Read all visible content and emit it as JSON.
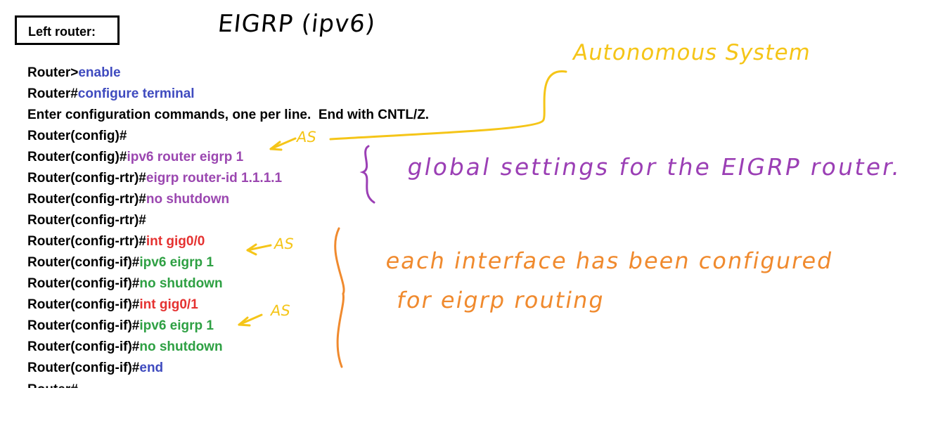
{
  "header": {
    "label": "Left router:",
    "handwritten_title": "EIGRP (ipv6)"
  },
  "cli": {
    "lines": [
      [
        {
          "t": "Router>",
          "c": "black"
        },
        {
          "t": "enable",
          "c": "blue"
        }
      ],
      [
        {
          "t": "Router#",
          "c": "black"
        },
        {
          "t": "configure terminal",
          "c": "blue"
        }
      ],
      [
        {
          "t": "Enter configuration commands, one per line.  End with CNTL/Z.",
          "c": "black"
        }
      ],
      [
        {
          "t": "Router(config)#",
          "c": "black"
        }
      ],
      [
        {
          "t": "Router(config)#",
          "c": "black"
        },
        {
          "t": "ipv6 router eigrp 1",
          "c": "purple"
        }
      ],
      [
        {
          "t": "Router(config-rtr)#",
          "c": "black"
        },
        {
          "t": "eigrp router-id 1.1.1.1",
          "c": "purple"
        }
      ],
      [
        {
          "t": "Router(config-rtr)#",
          "c": "black"
        },
        {
          "t": "no shutdown",
          "c": "purple"
        }
      ],
      [
        {
          "t": "Router(config-rtr)#",
          "c": "black"
        }
      ],
      [
        {
          "t": "Router(config-rtr)#",
          "c": "black"
        },
        {
          "t": "int gig0/0",
          "c": "red"
        }
      ],
      [
        {
          "t": "Router(config-if)#",
          "c": "black"
        },
        {
          "t": "ipv6 eigrp 1",
          "c": "green"
        }
      ],
      [
        {
          "t": "Router(config-if)#",
          "c": "black"
        },
        {
          "t": "no shutdown",
          "c": "green"
        }
      ],
      [
        {
          "t": "Router(config-if)#",
          "c": "black"
        },
        {
          "t": "int gig0/1",
          "c": "red"
        }
      ],
      [
        {
          "t": "Router(config-if)#",
          "c": "black"
        },
        {
          "t": "ipv6 eigrp 1",
          "c": "green"
        }
      ],
      [
        {
          "t": "Router(config-if)#",
          "c": "black"
        },
        {
          "t": "no shutdown",
          "c": "green"
        }
      ],
      [
        {
          "t": "Router(config-if)#",
          "c": "black"
        },
        {
          "t": "end",
          "c": "blue"
        }
      ]
    ],
    "cut_line": "Router#"
  },
  "annotations": {
    "autonomous_system": "Autonomous System",
    "as_label": "AS",
    "global_settings": "global settings for the EIGRP router.",
    "interfaces_line1": "each interface has been configured",
    "interfaces_line2": "for eigrp routing"
  },
  "colors": {
    "black": "#000000",
    "blue": "#3f4bbf",
    "purple": "#9b47b0",
    "red": "#e53231",
    "green": "#2ea043",
    "yellow": "#f5c518",
    "ink_purple": "#9b3fb5",
    "ink_orange": "#f08a2e"
  }
}
